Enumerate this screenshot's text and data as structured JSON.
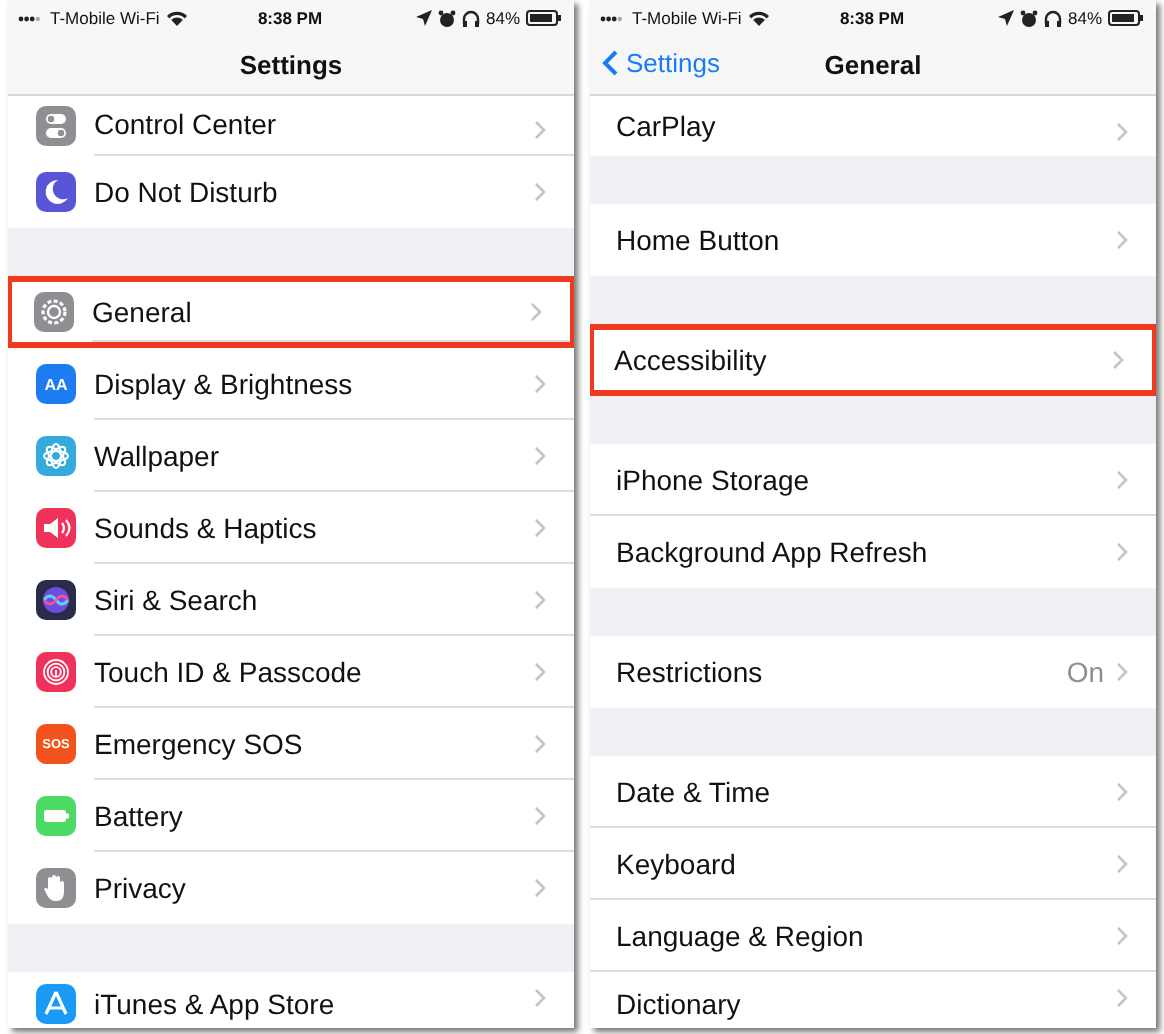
{
  "screens": [
    {
      "status_bar": {
        "carrier": "T-Mobile Wi-Fi",
        "time": "8:38 PM",
        "battery": "84%"
      },
      "nav": {
        "title": "Settings"
      },
      "groups": [
        {
          "rows": [
            {
              "label": "Control Center",
              "color": "#8e8e93",
              "highlighted": false
            },
            {
              "label": "Do Not Disturb",
              "color": "#5856d6",
              "highlighted": false
            }
          ]
        },
        {
          "rows": [
            {
              "label": "General",
              "color": "#8e8e93",
              "highlighted": true
            },
            {
              "label": "Display & Brightness",
              "color": "#1e7cf2",
              "icon_text": "AA",
              "highlighted": false
            },
            {
              "label": "Wallpaper",
              "color": "#35aadc",
              "highlighted": false
            },
            {
              "label": "Sounds & Haptics",
              "color": "#f0325a",
              "highlighted": false
            },
            {
              "label": "Siri & Search",
              "color": "#2a2a4a",
              "highlighted": false
            },
            {
              "label": "Touch ID & Passcode",
              "color": "#f0325a",
              "highlighted": false
            },
            {
              "label": "Emergency SOS",
              "color": "#f2521c",
              "icon_text": "SOS",
              "highlighted": false
            },
            {
              "label": "Battery",
              "color": "#4cd964",
              "highlighted": false
            },
            {
              "label": "Privacy",
              "color": "#8e8e93",
              "highlighted": false
            }
          ]
        },
        {
          "rows": [
            {
              "label": "iTunes & App Store",
              "color": "#1a9af5",
              "highlighted": false
            }
          ]
        }
      ]
    },
    {
      "status_bar": {
        "carrier": "T-Mobile Wi-Fi",
        "time": "8:38 PM",
        "battery": "84%"
      },
      "nav": {
        "back": "Settings",
        "title": "General"
      },
      "groups": [
        {
          "rows": [
            {
              "label": "CarPlay",
              "highlighted": false
            }
          ]
        },
        {
          "rows": [
            {
              "label": "Home Button",
              "highlighted": false
            }
          ]
        },
        {
          "rows": [
            {
              "label": "Accessibility",
              "highlighted": true
            }
          ]
        },
        {
          "rows": [
            {
              "label": "iPhone Storage",
              "highlighted": false
            },
            {
              "label": "Background App Refresh",
              "highlighted": false
            }
          ]
        },
        {
          "rows": [
            {
              "label": "Restrictions",
              "value": "On",
              "highlighted": false
            }
          ]
        },
        {
          "rows": [
            {
              "label": "Date & Time",
              "highlighted": false
            },
            {
              "label": "Keyboard",
              "highlighted": false
            },
            {
              "label": "Language & Region",
              "highlighted": false
            },
            {
              "label": "Dictionary",
              "highlighted": false
            }
          ]
        }
      ]
    }
  ]
}
